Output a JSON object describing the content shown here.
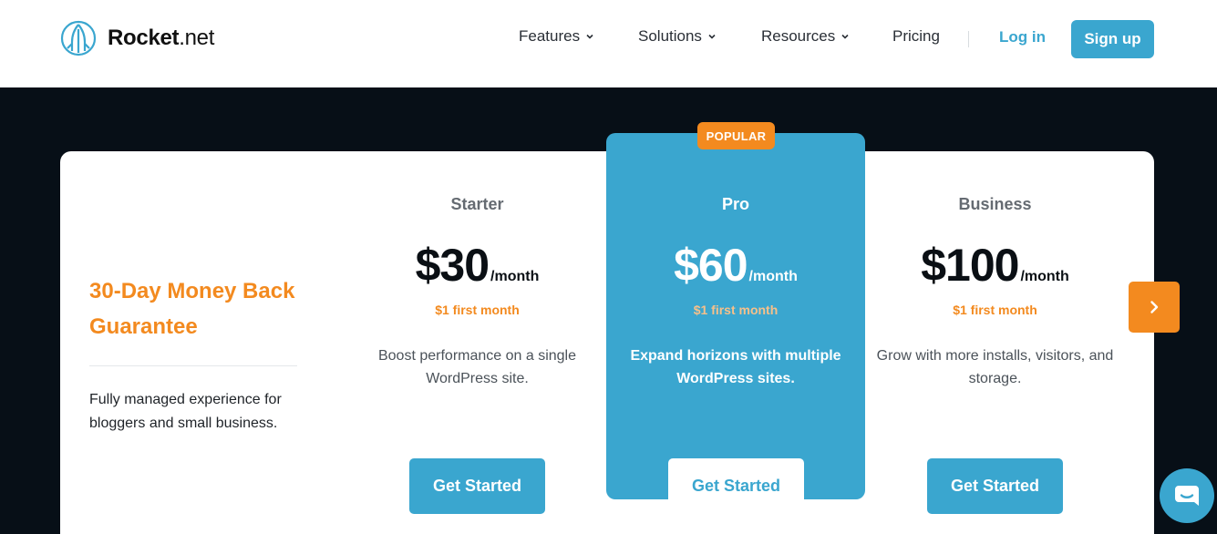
{
  "header": {
    "logo_bold": "Rocket",
    "logo_light": ".net",
    "nav": [
      {
        "label": "Features",
        "has_dropdown": true
      },
      {
        "label": "Solutions",
        "has_dropdown": true
      },
      {
        "label": "Resources",
        "has_dropdown": true
      },
      {
        "label": "Pricing",
        "has_dropdown": false
      }
    ],
    "login_label": "Log in",
    "signup_label": "Sign up"
  },
  "pricing": {
    "guarantee_title": "30-Day Money Back Guarantee",
    "guarantee_desc": "Fully managed experience for bloggers and small business.",
    "plans": [
      {
        "name": "Starter",
        "price": "$30",
        "period": "/month",
        "first_month": "$1 first month",
        "description": "Boost performance on a single WordPress site.",
        "cta": "Get Started"
      },
      {
        "name": "Pro",
        "price": "$60",
        "period": "/month",
        "first_month": "$1 first month",
        "description": "Expand horizons with multiple WordPress sites.",
        "cta": "Get Started",
        "badge": "POPULAR"
      },
      {
        "name": "Business",
        "price": "$100",
        "period": "/month",
        "first_month": "$1 first month",
        "description": "Grow with more installs, visitors, and storage.",
        "cta": "Get Started"
      }
    ]
  },
  "icons": {
    "logo": "rocket-logo-icon",
    "dropdown": "chevron-down-icon",
    "next": "chevron-right-icon",
    "chat": "chat-bubble-icon"
  },
  "colors": {
    "brand_blue": "#3aa6cf",
    "accent_orange": "#f38a1f",
    "dark_band": "#070f17"
  }
}
